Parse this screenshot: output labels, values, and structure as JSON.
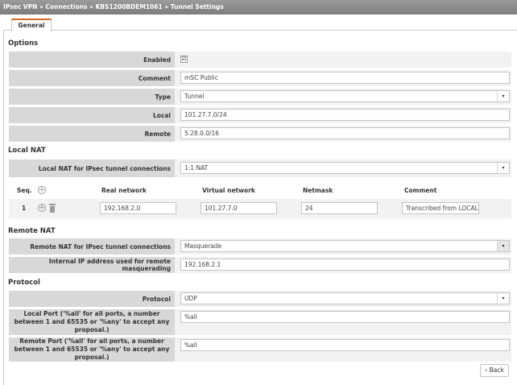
{
  "breadcrumb": [
    "IPsec VPN",
    "Connections",
    "KBS1200BDEM1061",
    "Tunnel Settings"
  ],
  "breadcrumb_sep": " » ",
  "tabs": [
    {
      "label": "General"
    }
  ],
  "sections": {
    "options": "Options",
    "local_nat": "Local NAT",
    "remote_nat": "Remote NAT",
    "protocol": "Protocol"
  },
  "options": {
    "enabled_label": "Enabled",
    "enabled_checked": true,
    "check_glyph": "☑",
    "comment_label": "Comment",
    "comment_value": "mSC Public",
    "type_label": "Type",
    "type_value": "Tunnel",
    "local_label": "Local",
    "local_value": "101.27.7.0/24",
    "remote_label": "Remote",
    "remote_value": "5.28.0.0/16"
  },
  "local_nat": {
    "label": "Local NAT for IPsec tunnel connections",
    "value": "1:1 NAT",
    "columns": [
      "Seq.",
      "Real network",
      "Virtual network",
      "Netmask",
      "Comment"
    ],
    "rows": [
      {
        "seq": "1",
        "real": "192.168.2.0",
        "virtual": "101.27.7.0",
        "netmask": "24",
        "comment": "Transcribed from LOCAL_"
      }
    ]
  },
  "remote_nat": {
    "label": "Remote NAT for IPsec tunnel connections",
    "value": "Masquerade",
    "internal_label": "Internal IP address used for remote masquerading",
    "internal_value": "192.168.2.1"
  },
  "protocol": {
    "protocol_label": "Protocol",
    "protocol_value": "UDP",
    "local_port_label": "Local Port ('%all' for all ports, a number between 1 and 65535 or '%any' to accept any proposal.)",
    "local_port_value": "%all",
    "remote_port_label": "Remote Port ('%all' for all ports, a number between 1 and 65535 or '%any' to accept any proposal.)",
    "remote_port_value": "%all"
  },
  "back_label": "‹ Back",
  "icons": {
    "dropdown": "▾",
    "plus": "+"
  },
  "colors": {
    "accent": "#d86a1e",
    "header_bg": "#8c8c8c",
    "label_bg": "#d8d8d8",
    "row_bg": "#f2f2f2"
  }
}
